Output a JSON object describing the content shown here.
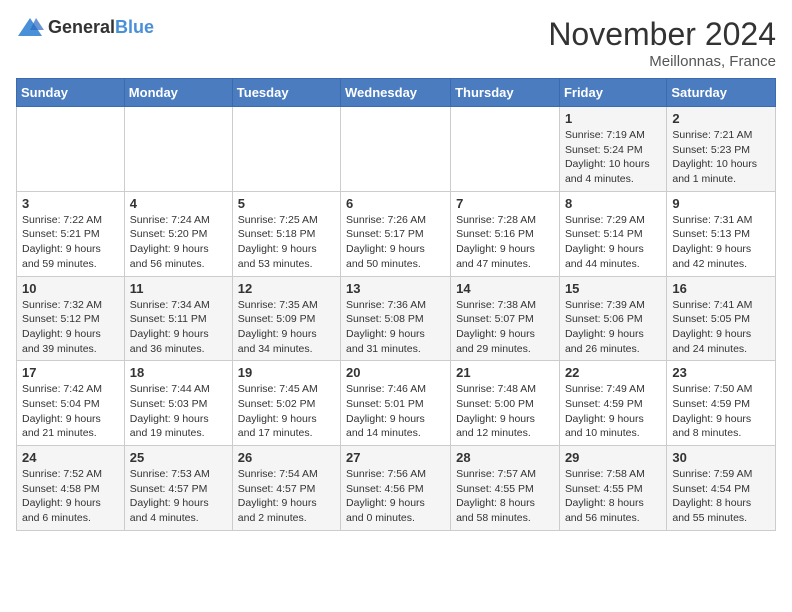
{
  "logo": {
    "general": "General",
    "blue": "Blue"
  },
  "title": "November 2024",
  "location": "Meillonnas, France",
  "days_of_week": [
    "Sunday",
    "Monday",
    "Tuesday",
    "Wednesday",
    "Thursday",
    "Friday",
    "Saturday"
  ],
  "weeks": [
    [
      {
        "day": "",
        "info": ""
      },
      {
        "day": "",
        "info": ""
      },
      {
        "day": "",
        "info": ""
      },
      {
        "day": "",
        "info": ""
      },
      {
        "day": "",
        "info": ""
      },
      {
        "day": "1",
        "info": "Sunrise: 7:19 AM\nSunset: 5:24 PM\nDaylight: 10 hours and 4 minutes."
      },
      {
        "day": "2",
        "info": "Sunrise: 7:21 AM\nSunset: 5:23 PM\nDaylight: 10 hours and 1 minute."
      }
    ],
    [
      {
        "day": "3",
        "info": "Sunrise: 7:22 AM\nSunset: 5:21 PM\nDaylight: 9 hours and 59 minutes."
      },
      {
        "day": "4",
        "info": "Sunrise: 7:24 AM\nSunset: 5:20 PM\nDaylight: 9 hours and 56 minutes."
      },
      {
        "day": "5",
        "info": "Sunrise: 7:25 AM\nSunset: 5:18 PM\nDaylight: 9 hours and 53 minutes."
      },
      {
        "day": "6",
        "info": "Sunrise: 7:26 AM\nSunset: 5:17 PM\nDaylight: 9 hours and 50 minutes."
      },
      {
        "day": "7",
        "info": "Sunrise: 7:28 AM\nSunset: 5:16 PM\nDaylight: 9 hours and 47 minutes."
      },
      {
        "day": "8",
        "info": "Sunrise: 7:29 AM\nSunset: 5:14 PM\nDaylight: 9 hours and 44 minutes."
      },
      {
        "day": "9",
        "info": "Sunrise: 7:31 AM\nSunset: 5:13 PM\nDaylight: 9 hours and 42 minutes."
      }
    ],
    [
      {
        "day": "10",
        "info": "Sunrise: 7:32 AM\nSunset: 5:12 PM\nDaylight: 9 hours and 39 minutes."
      },
      {
        "day": "11",
        "info": "Sunrise: 7:34 AM\nSunset: 5:11 PM\nDaylight: 9 hours and 36 minutes."
      },
      {
        "day": "12",
        "info": "Sunrise: 7:35 AM\nSunset: 5:09 PM\nDaylight: 9 hours and 34 minutes."
      },
      {
        "day": "13",
        "info": "Sunrise: 7:36 AM\nSunset: 5:08 PM\nDaylight: 9 hours and 31 minutes."
      },
      {
        "day": "14",
        "info": "Sunrise: 7:38 AM\nSunset: 5:07 PM\nDaylight: 9 hours and 29 minutes."
      },
      {
        "day": "15",
        "info": "Sunrise: 7:39 AM\nSunset: 5:06 PM\nDaylight: 9 hours and 26 minutes."
      },
      {
        "day": "16",
        "info": "Sunrise: 7:41 AM\nSunset: 5:05 PM\nDaylight: 9 hours and 24 minutes."
      }
    ],
    [
      {
        "day": "17",
        "info": "Sunrise: 7:42 AM\nSunset: 5:04 PM\nDaylight: 9 hours and 21 minutes."
      },
      {
        "day": "18",
        "info": "Sunrise: 7:44 AM\nSunset: 5:03 PM\nDaylight: 9 hours and 19 minutes."
      },
      {
        "day": "19",
        "info": "Sunrise: 7:45 AM\nSunset: 5:02 PM\nDaylight: 9 hours and 17 minutes."
      },
      {
        "day": "20",
        "info": "Sunrise: 7:46 AM\nSunset: 5:01 PM\nDaylight: 9 hours and 14 minutes."
      },
      {
        "day": "21",
        "info": "Sunrise: 7:48 AM\nSunset: 5:00 PM\nDaylight: 9 hours and 12 minutes."
      },
      {
        "day": "22",
        "info": "Sunrise: 7:49 AM\nSunset: 4:59 PM\nDaylight: 9 hours and 10 minutes."
      },
      {
        "day": "23",
        "info": "Sunrise: 7:50 AM\nSunset: 4:59 PM\nDaylight: 9 hours and 8 minutes."
      }
    ],
    [
      {
        "day": "24",
        "info": "Sunrise: 7:52 AM\nSunset: 4:58 PM\nDaylight: 9 hours and 6 minutes."
      },
      {
        "day": "25",
        "info": "Sunrise: 7:53 AM\nSunset: 4:57 PM\nDaylight: 9 hours and 4 minutes."
      },
      {
        "day": "26",
        "info": "Sunrise: 7:54 AM\nSunset: 4:57 PM\nDaylight: 9 hours and 2 minutes."
      },
      {
        "day": "27",
        "info": "Sunrise: 7:56 AM\nSunset: 4:56 PM\nDaylight: 9 hours and 0 minutes."
      },
      {
        "day": "28",
        "info": "Sunrise: 7:57 AM\nSunset: 4:55 PM\nDaylight: 8 hours and 58 minutes."
      },
      {
        "day": "29",
        "info": "Sunrise: 7:58 AM\nSunset: 4:55 PM\nDaylight: 8 hours and 56 minutes."
      },
      {
        "day": "30",
        "info": "Sunrise: 7:59 AM\nSunset: 4:54 PM\nDaylight: 8 hours and 55 minutes."
      }
    ]
  ]
}
